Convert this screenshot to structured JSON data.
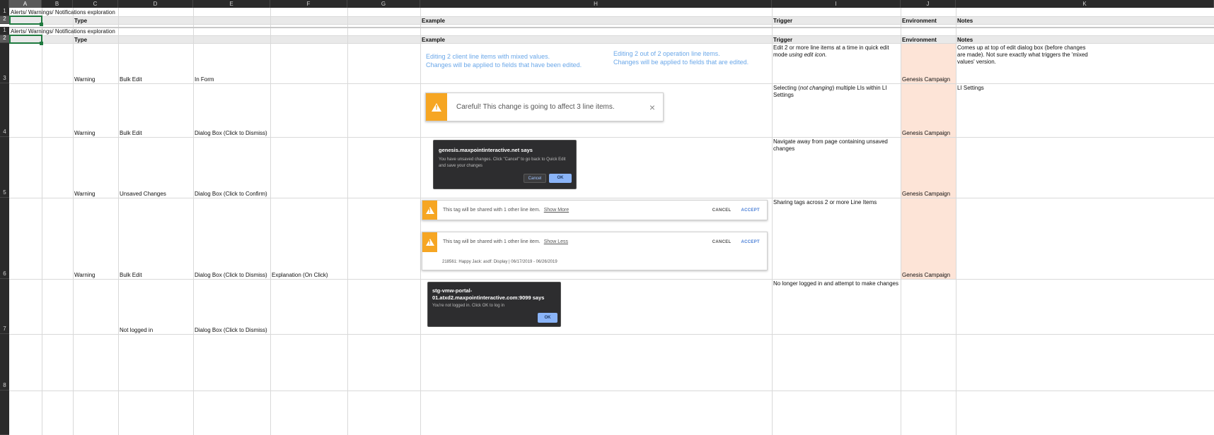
{
  "columns": [
    "A",
    "B",
    "C",
    "D",
    "E",
    "F",
    "G",
    "H",
    "I",
    "J",
    "K"
  ],
  "rows": [
    "1",
    "2",
    "1",
    "2",
    "3",
    "4",
    "5",
    "6",
    "7",
    "8"
  ],
  "sheet_title": "Alerts/ Warnings/ Notifications exploration",
  "headers": {
    "type": "Type",
    "example": "Example",
    "trigger": "Trigger",
    "environment": "Environment",
    "notes": "Notes"
  },
  "data_rows": [
    {
      "type": "Warning",
      "subtype": "Bulk Edit",
      "kind": "In Form",
      "extra": "",
      "trigger_plain": "Edit 2 or more line items at a time in quick edit mode",
      "trigger_italic": "using edit icon.",
      "environment": "Genesis Campaign",
      "notes": "Comes up at top of edit dialog box (before changes are made). Not sure exactly what triggers the 'mixed values' version."
    },
    {
      "type": "Warning",
      "subtype": "Bulk Edit",
      "kind": "Dialog Box (Click to Dismiss)",
      "extra": "",
      "trigger_a": "Selecting (",
      "trigger_italic": "not changing",
      "trigger_b": ") multiple LIs within LI Settings",
      "environment": "Genesis Campaign",
      "notes": "LI Settings"
    },
    {
      "type": "Warning",
      "subtype": "Unsaved Changes",
      "kind": "Dialog Box (Click to Confirm)",
      "extra": "",
      "trigger": "Navigate away from page containing unsaved changes",
      "environment": "Genesis Campaign",
      "notes": ""
    },
    {
      "type": "Warning",
      "subtype": "Bulk Edit",
      "kind": "Dialog Box (Click to Dismiss)",
      "extra": "Explanation (On Click)",
      "trigger": "Sharing tags across 2 or more Line Items",
      "environment": "Genesis Campaign",
      "notes": ""
    },
    {
      "type": "",
      "subtype": "Not logged in",
      "kind": "Dialog Box (Click to Dismiss)",
      "extra": "",
      "trigger": "No longer logged in and attempt to make changes",
      "environment": "",
      "notes": ""
    }
  ],
  "examples": {
    "inform_left_1": "Editing 2 client line items with mixed values.",
    "inform_left_2": "Changes will be applied to fields that have been edited.",
    "inform_right_1": "Editing 2 out of 2 operation line items.",
    "inform_right_2": "Changes will be applied to fields that are edited.",
    "careful_text": "Careful! This change is going to affect 3 line items.",
    "careful_close": "×",
    "unsaved_title": "genesis.maxpointinteractive.net says",
    "unsaved_body": "You have unsaved changes. Click \"Cancel\" to go back to Quick Edit and save your changes",
    "unsaved_cancel": "Cancel",
    "unsaved_ok": "OK",
    "tag_text": "This tag will be shared with 1 other line item.",
    "tag_show_more": "Show More",
    "tag_show_less": "Show Less",
    "tag_cancel": "CANCEL",
    "tag_accept": "ACCEPT",
    "tag_detail": "218561: Happy Jack: asdf: Display | 06/17/2019 - 06/26/2019",
    "login_title": "stg-vmw-portal-01.atxd2.maxpointinteractive.com:9099 says",
    "login_body": "You're not logged in. Click OK to log in",
    "login_ok": "OK"
  },
  "colors": {
    "environment_fill": "#fde4d7",
    "warning_orange": "#f6a623",
    "example_blue": "#6aa7e8",
    "dialog_bg": "#2d2d2f",
    "selection_green": "#1f7a3f"
  }
}
